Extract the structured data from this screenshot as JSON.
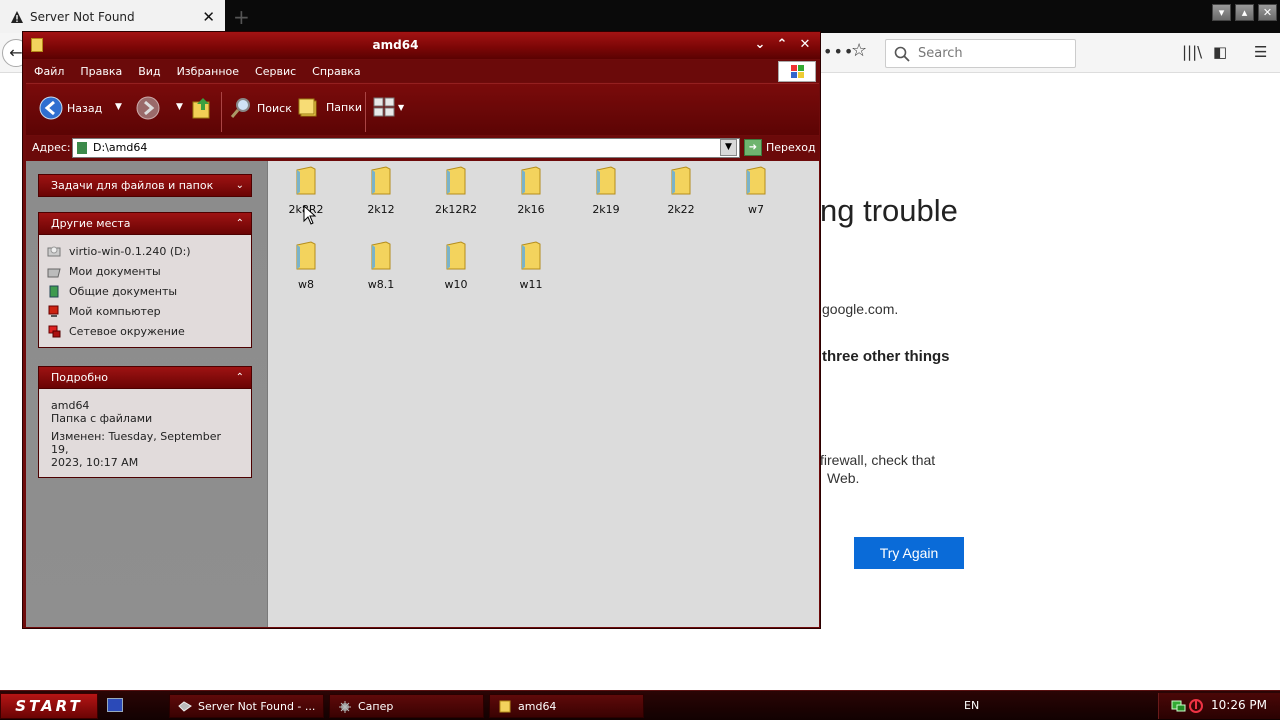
{
  "browser": {
    "tab_title": "Server Not Found",
    "search_placeholder": "Search",
    "error_title": "ng trouble",
    "error_line1": "google.com.",
    "error_line2": "three other things",
    "error_line3a": "firewall, check that",
    "error_line3b": "Web.",
    "try_again_label": "Try Again"
  },
  "explorer": {
    "title": "amd64",
    "menu": [
      "Файл",
      "Правка",
      "Вид",
      "Избранное",
      "Сервис",
      "Справка"
    ],
    "toolbar": {
      "back_label": "Назад",
      "search_label": "Поиск",
      "folders_label": "Папки"
    },
    "address_label": "Адрес:",
    "address_value": "D:\\amd64",
    "go_label": "Переход",
    "tasks_panel": {
      "title": "Задачи для файлов и папок"
    },
    "places_panel": {
      "title": "Другие места",
      "items": [
        {
          "label": "virtio-win-0.1.240 (D:)"
        },
        {
          "label": "Мои документы"
        },
        {
          "label": "Общие документы"
        },
        {
          "label": "Мой компьютер"
        },
        {
          "label": "Сетевое окружение"
        }
      ]
    },
    "details_panel": {
      "title": "Подробно",
      "name": "amd64",
      "type": "Папка с файлами",
      "modified_line1": "Изменен: Tuesday, September 19,",
      "modified_line2": "2023, 10:17 AM"
    },
    "folders": [
      {
        "name": "2k8R2"
      },
      {
        "name": "2k12"
      },
      {
        "name": "2k12R2"
      },
      {
        "name": "2k16"
      },
      {
        "name": "2k19"
      },
      {
        "name": "2k22"
      },
      {
        "name": "w7"
      },
      {
        "name": "w8"
      },
      {
        "name": "w8.1"
      },
      {
        "name": "w10"
      },
      {
        "name": "w11"
      }
    ]
  },
  "taskbar": {
    "start_label": "START",
    "tasks": [
      {
        "label": "Server Not Found - ..."
      },
      {
        "label": "Сапер"
      },
      {
        "label": "amd64"
      }
    ],
    "language": "EN",
    "clock": "10:26 PM"
  }
}
